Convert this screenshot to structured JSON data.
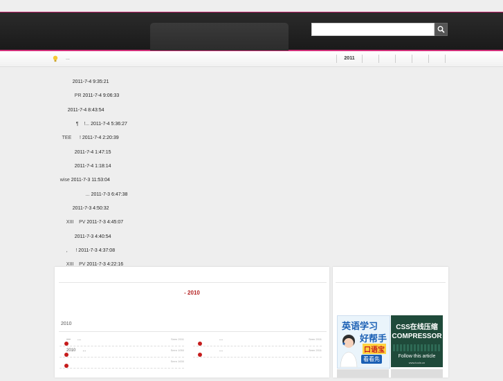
{
  "search": {
    "placeholder": "",
    "value": ""
  },
  "infobar": {
    "text": "...",
    "year_active": "2011"
  },
  "entries": [
    {
      "prefix": "",
      "stamp": "2011-7-4 9:35:21"
    },
    {
      "prefix": "PR",
      "stamp": "2011-7-4 9:06:33"
    },
    {
      "prefix": "",
      "stamp": "2011-7-4 8:43:54"
    },
    {
      "prefix": "¶    !...",
      "stamp": "2011-7-4 5:36:27"
    },
    {
      "prefix": "TEE      !",
      "stamp": "2011-7-4 2:20:39"
    },
    {
      "prefix": "",
      "stamp": "2011-7-4 1:47:15"
    },
    {
      "prefix": "",
      "stamp": "2011-7-4 1:18:14"
    },
    {
      "prefix": "wise",
      "stamp": "2011-7-3 11:53:04"
    },
    {
      "prefix": "...",
      "stamp": "2011-7-3 6:47:38"
    },
    {
      "prefix": "",
      "stamp": "2011-7-3 4:50:32"
    },
    {
      "prefix": "XIII    PV",
      "stamp": "2011-7-3 4:45:07"
    },
    {
      "prefix": "",
      "stamp": "2011-7-3 4:40:54"
    },
    {
      "prefix": ",      !",
      "stamp": "2011-7-3 4:37:08"
    },
    {
      "prefix": "XIII    PV",
      "stamp": "2011-7-3 4:22:16"
    }
  ],
  "main_panel": {
    "title": "- 2010",
    "sub_year": "2010",
    "rows": [
      {
        "text": "—      ...",
        "meta": "Seen 2011"
      },
      {
        "text": "...",
        "meta": "Seen 2011"
      },
      {
        "text": "2010      ...",
        "meta": "Seen 1050"
      },
      {
        "text": "...",
        "meta": "Seen 2011"
      },
      {
        "text": "",
        "meta": "Seen 1630"
      }
    ]
  },
  "ads": {
    "english": {
      "line1": "英语学习",
      "line2": "好帮手",
      "line3": "口语宝",
      "line4": "看看先"
    },
    "css": {
      "line1": "CSS在线压缩",
      "line2": "COMPRESSOR",
      "line3": "Follow this article",
      "line4": "www.tooln.cn"
    }
  },
  "colors": {
    "accent": "#d2307a",
    "title_red": "#b42020",
    "bullet": "#c61c1c"
  }
}
